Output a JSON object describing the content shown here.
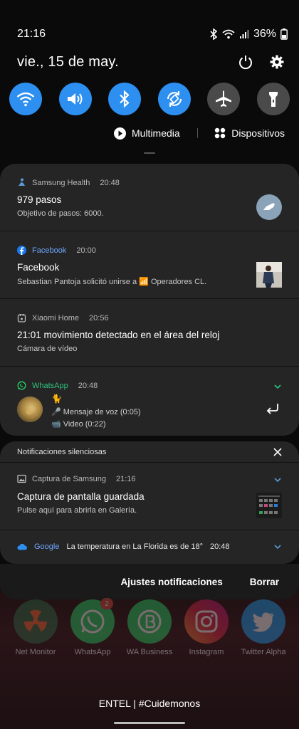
{
  "status_bar": {
    "time": "21:16",
    "battery": "36%"
  },
  "header": {
    "date": "vie., 15 de may."
  },
  "quick_settings": [
    {
      "name": "wifi-icon",
      "state": "on"
    },
    {
      "name": "sound-icon",
      "state": "on"
    },
    {
      "name": "bluetooth-icon",
      "state": "on"
    },
    {
      "name": "auto-rotate-icon",
      "state": "on"
    },
    {
      "name": "airplane-icon",
      "state": "off"
    },
    {
      "name": "flashlight-icon",
      "state": "off"
    }
  ],
  "media": {
    "multimedia_label": "Multimedia",
    "devices_label": "Dispositivos"
  },
  "notifications": [
    {
      "app": "Samsung Health",
      "time": "20:48",
      "title": "979 pasos",
      "body": "Objetivo de pasos: 6000."
    },
    {
      "app": "Facebook",
      "time": "20:00",
      "title": "Facebook",
      "body": "Sebastian Pantoja solicitó unirse a 📶 Operadores CL."
    },
    {
      "app": "Xiaomi Home",
      "time": "20:56",
      "title": "21:01 movimiento detectado en el área del reloj",
      "body": "Cámara de vídeo"
    },
    {
      "app": "WhatsApp",
      "time": "20:48",
      "line1": "🐈",
      "line2": "🎤 Mensaje de voz (0:05)",
      "line3": "📹 Video (0:22)"
    }
  ],
  "silent": {
    "header": "Notificaciones silenciosas",
    "capture": {
      "app": "Captura de Samsung",
      "time": "21:16",
      "title": "Captura de pantalla guardada",
      "body": "Pulse aquí para abrirla en Galería."
    },
    "google": {
      "app": "Google",
      "text": "La temperatura en La Florida es de 18°",
      "time": "20:48"
    }
  },
  "actions": {
    "settings_label": "Ajustes notificaciones",
    "clear_label": "Borrar"
  },
  "dock": [
    {
      "label": "Net Monitor",
      "color": "#2a5a3a"
    },
    {
      "label": "WhatsApp",
      "color": "#25d366",
      "badge": "2"
    },
    {
      "label": "WA Business",
      "color": "#25d366"
    },
    {
      "label": "Instagram",
      "color": "#c13584"
    },
    {
      "label": "Twitter Alpha",
      "color": "#1da1f2"
    }
  ],
  "carrier": "ENTEL | #Cuidemonos"
}
